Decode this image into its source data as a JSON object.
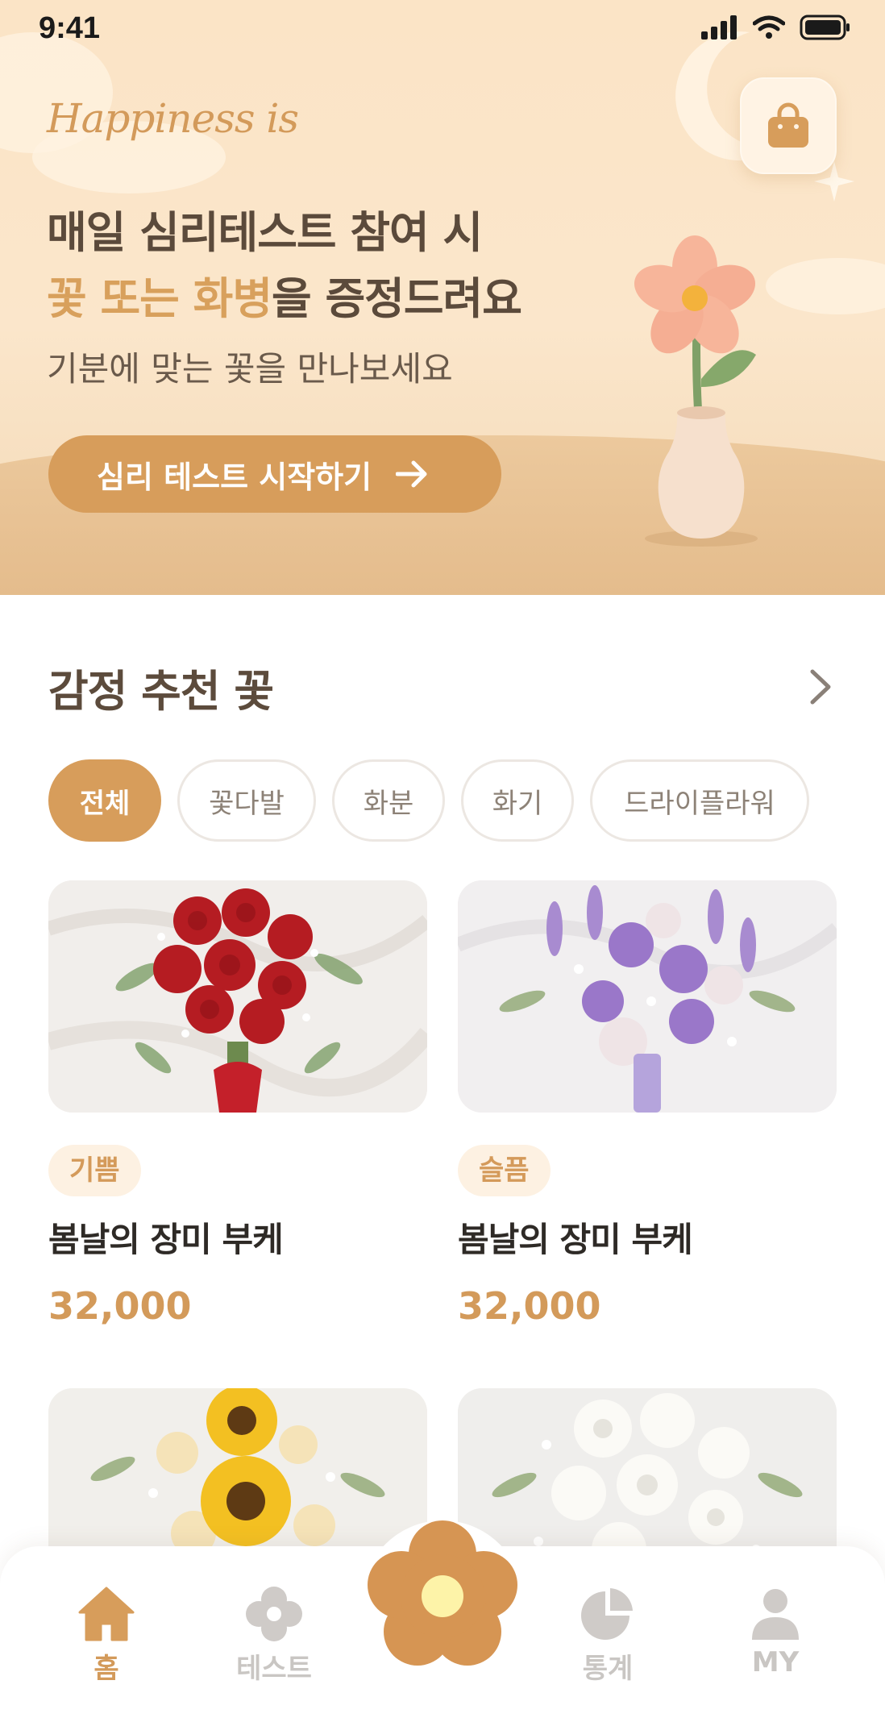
{
  "status_bar": {
    "time": "9:41"
  },
  "hero": {
    "tagline": "Happiness is",
    "headline_line1": "매일 심리테스트 참여 시",
    "headline_line2_accent": "꽃 또는 화병",
    "headline_line2_rest": "을 증정드려요",
    "subline": "기분에 맞는 꽃을 만나보세요",
    "cta_label": "심리 테스트 시작하기"
  },
  "section": {
    "title": "감정 추천 꽃",
    "filters": [
      {
        "label": "전체",
        "active": true
      },
      {
        "label": "꽃다발",
        "active": false
      },
      {
        "label": "화분",
        "active": false
      },
      {
        "label": "화기",
        "active": false
      },
      {
        "label": "드라이플라워",
        "active": false
      }
    ]
  },
  "products": [
    {
      "mood": "기쁨",
      "name": "봄날의 장미 부케",
      "price": "32,000"
    },
    {
      "mood": "슬픔",
      "name": "봄날의 장미 부케",
      "price": "32,000"
    }
  ],
  "bottom_nav": {
    "items": [
      {
        "label": "홈",
        "icon": "home-icon",
        "active": true
      },
      {
        "label": "테스트",
        "icon": "flower-icon",
        "active": false
      },
      {
        "label": "통계",
        "icon": "pie-chart-icon",
        "active": false
      },
      {
        "label": "MY",
        "icon": "user-icon",
        "active": false
      }
    ]
  },
  "colors": {
    "accent": "#d79d5b",
    "text_dark": "#5b4a3b",
    "badge_bg": "#fdf1e2",
    "inactive": "#c9c6c3"
  }
}
